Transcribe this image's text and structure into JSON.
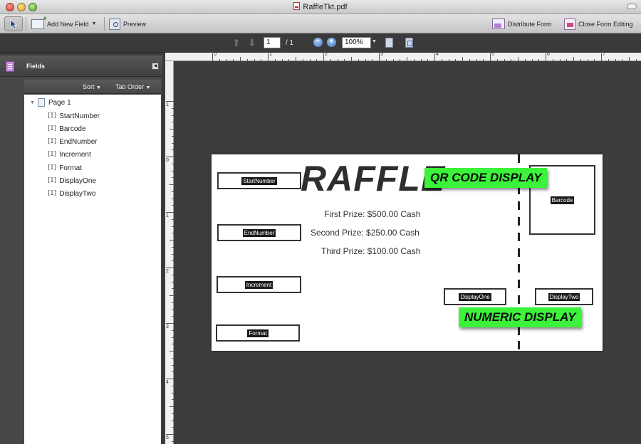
{
  "window": {
    "title": "RaffleTkt.pdf"
  },
  "toolbar": {
    "add_new_field_label": "Add New Field",
    "preview_label": "Preview",
    "distribute_form_label": "Distribute Form",
    "close_form_editing_label": "Close Form Editing"
  },
  "nav": {
    "current_page": "1",
    "page_total": "/ 1",
    "zoom": "100%"
  },
  "panel": {
    "title": "Fields",
    "sort_label": "Sort",
    "tab_order_label": "Tab Order",
    "tree": {
      "page_label": "Page 1",
      "fields": [
        "StartNumber",
        "Barcode",
        "EndNumber",
        "Increment",
        "Format",
        "DisplayOne",
        "DisplayTwo"
      ]
    }
  },
  "ruler": {
    "top_numbers": [
      "0",
      "1",
      "2",
      "3",
      "4",
      "5",
      "6",
      "7"
    ],
    "left_numbers": [
      "1",
      "0",
      "1",
      "2",
      "3",
      "4",
      "5"
    ]
  },
  "document": {
    "heading": "RAFFLE",
    "prizes": [
      "First Prize: $500.00 Cash",
      "Second Prize: $250.00 Cash",
      "Third Prize: $100.00 Cash"
    ],
    "fields": {
      "start_number": "StartNumber",
      "end_number": "EndNumber",
      "increment": "Increment",
      "format": "Format",
      "barcode": "Barcode",
      "display_one": "DisplayOne",
      "display_two": "DisplayTwo"
    },
    "callouts": {
      "qr_code": "QR CODE DISPLAY",
      "numeric": "NUMERIC DISPLAY"
    }
  },
  "colors": {
    "callout_green": "#3cf23a",
    "workspace": "#3d3d3d"
  }
}
